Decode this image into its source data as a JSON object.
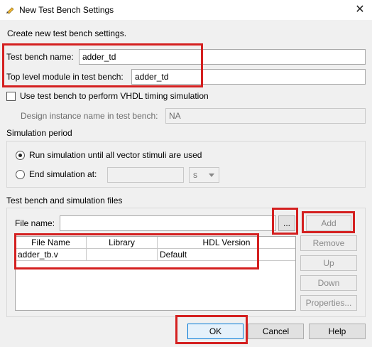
{
  "window": {
    "title": "New Test Bench Settings",
    "close_glyph": "✕"
  },
  "intro": "Create new test bench settings.",
  "test_bench_name": {
    "label": "Test bench name:",
    "value": "adder_td"
  },
  "top_level_module": {
    "label": "Top level module in test bench:",
    "value": "adder_td"
  },
  "vhdl_timing": {
    "label": "Use test bench to perform VHDL timing simulation",
    "checked": false
  },
  "design_instance": {
    "label": "Design instance name in test bench:",
    "value": "NA"
  },
  "simulation_period": {
    "heading": "Simulation period",
    "run_until_label": "Run simulation until all vector stimuli are used",
    "end_at_label": "End simulation at:",
    "end_value": "",
    "unit": "s"
  },
  "files_section": {
    "heading": "Test bench and simulation files",
    "file_name_label": "File name:",
    "file_name_value": "",
    "browse_label": "...",
    "add_label": "Add",
    "remove_label": "Remove",
    "up_label": "Up",
    "down_label": "Down",
    "properties_label": "Properties...",
    "columns": [
      "File Name",
      "Library",
      "HDL Version"
    ],
    "rows": [
      [
        "adder_tb.v",
        "",
        "Default"
      ]
    ]
  },
  "footer": {
    "ok_label": "OK",
    "cancel_label": "Cancel",
    "help_label": "Help"
  },
  "colors": {
    "highlight": "#d42020",
    "focus": "#0078d7"
  }
}
